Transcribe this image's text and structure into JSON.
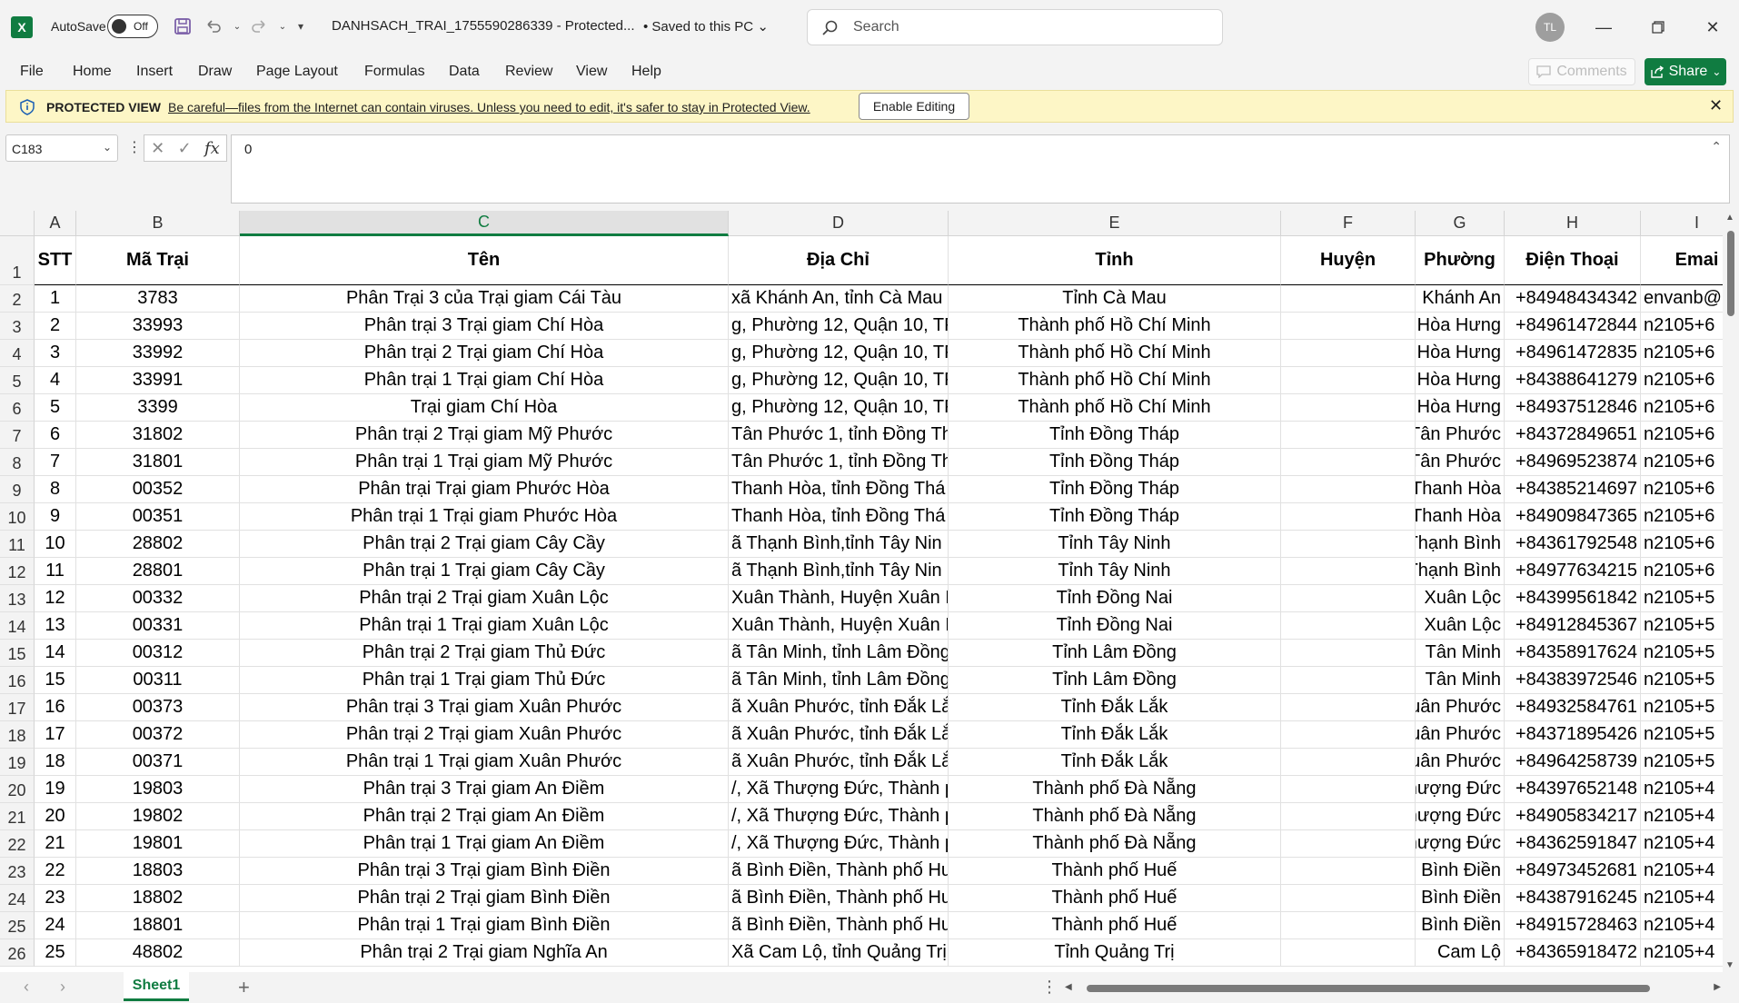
{
  "titlebar": {
    "app_logo": "X",
    "autosave_label": "AutoSave",
    "autosave_state": "Off",
    "filename": "DANHSACH_TRAI_1755590286339  -  Protected...",
    "saved_status": "•  Saved to this PC",
    "search_placeholder": "Search",
    "user_initials": "TL"
  },
  "menu": {
    "items": [
      "File",
      "Home",
      "Insert",
      "Draw",
      "Page Layout",
      "Formulas",
      "Data",
      "Review",
      "View",
      "Help"
    ],
    "comments": "Comments",
    "share": "Share"
  },
  "protected_view": {
    "title": "PROTECTED VIEW",
    "message": "Be careful—files from the Internet can contain viruses. Unless you need to edit, it's safer to stay in Protected View.",
    "button": "Enable Editing"
  },
  "formula_bar": {
    "name_box": "C183",
    "fx": "fx",
    "value": "0"
  },
  "sheet": {
    "columns": [
      "A",
      "B",
      "C",
      "D",
      "E",
      "F",
      "G",
      "H",
      "I"
    ],
    "selected_column": "C",
    "row_numbers": [
      "1",
      "2",
      "3",
      "4",
      "5",
      "6",
      "7",
      "8",
      "9",
      "10",
      "11",
      "12",
      "13",
      "14",
      "15",
      "16",
      "17",
      "18",
      "19",
      "20",
      "21",
      "22",
      "23",
      "24",
      "25",
      "26"
    ],
    "headers": [
      "STT",
      "Mã Trại",
      "Tên",
      "Địa Chỉ",
      "Tỉnh",
      "Huyện",
      "Phường",
      "Điện Thoại",
      "Emai"
    ],
    "rows": [
      [
        "1",
        "3783",
        "Phân Trại 3 của Trại giam Cái Tàu",
        "xã Khánh An, tỉnh Cà Mau",
        "Tỉnh Cà Mau",
        "",
        "Khánh An",
        "+84948434342",
        "envanb@"
      ],
      [
        "2",
        "33993",
        "Phân trại 3 Trại giam Chí Hòa",
        "g, Phường 12, Quận 10, TP",
        "Thành phố Hồ Chí Minh",
        "",
        "Hòa Hưng",
        "+84961472844",
        "n2105+6"
      ],
      [
        "3",
        "33992",
        "Phân trại 2 Trại giam Chí Hòa",
        "g, Phường 12, Quận 10, TP",
        "Thành phố Hồ Chí Minh",
        "",
        "Hòa Hưng",
        "+84961472835",
        "n2105+6"
      ],
      [
        "4",
        "33991",
        "Phân trại 1 Trại giam Chí Hòa",
        "g, Phường 12, Quận 10, TP",
        "Thành phố Hồ Chí Minh",
        "",
        "Hòa Hưng",
        "+84388641279",
        "n2105+6"
      ],
      [
        "5",
        "3399",
        "Trại giam Chí Hòa",
        "g, Phường 12, Quận 10, TP",
        "Thành phố Hồ Chí Minh",
        "",
        "Hòa Hưng",
        "+84937512846",
        "n2105+6"
      ],
      [
        "6",
        "31802",
        "Phân trại 2 Trại giam Mỹ Phước",
        "Tân Phước 1, tỉnh Đồng Th",
        "Tỉnh Đồng Tháp",
        "",
        "Tân Phước",
        "+84372849651",
        "n2105+6"
      ],
      [
        "7",
        "31801",
        "Phân trại 1 Trại giam Mỹ Phước",
        "Tân Phước 1, tỉnh Đồng Th",
        "Tỉnh Đồng Tháp",
        "",
        "Tân Phước",
        "+84969523874",
        "n2105+6"
      ],
      [
        "8",
        "00352",
        "Phân trại  Trại giam Phước Hòa",
        "Thanh Hòa, tỉnh Đồng Thá",
        "Tỉnh Đồng Tháp",
        "",
        "Thanh Hòa",
        "+84385214697",
        "n2105+6"
      ],
      [
        "9",
        "00351",
        "Phân trại 1 Trại giam Phước Hòa",
        "Thanh Hòa, tỉnh Đồng Thá",
        "Tỉnh Đồng Tháp",
        "",
        "Thanh Hòa",
        "+84909847365",
        "n2105+6"
      ],
      [
        "10",
        "28802",
        "Phân trại 2 Trại giam Cây Cầy",
        "ã Thạnh Bình,tỉnh Tây Nin",
        "Tỉnh Tây Ninh",
        "",
        "Thạnh Bình",
        "+84361792548",
        "n2105+6"
      ],
      [
        "11",
        "28801",
        "Phân trại 1 Trại giam Cây Cầy",
        "ã Thạnh Bình,tỉnh Tây Nin",
        "Tỉnh Tây Ninh",
        "",
        "Thạnh Bình",
        "+84977634215",
        "n2105+6"
      ],
      [
        "12",
        "00332",
        "Phân trại 2 Trại giam Xuân Lộc",
        "Xuân Thành, Huyện Xuân L",
        "Tỉnh Đồng Nai",
        "",
        "Xuân Lộc",
        "+84399561842",
        "n2105+5"
      ],
      [
        "13",
        "00331",
        "Phân trại 1 Trại giam Xuân Lộc",
        "Xuân Thành, Huyện Xuân L",
        "Tỉnh Đồng Nai",
        "",
        "Xuân Lộc",
        "+84912845367",
        "n2105+5"
      ],
      [
        "14",
        "00312",
        "Phân trại 2 Trại giam Thủ Đức",
        "ã Tân Minh, tỉnh Lâm Đồng",
        "Tỉnh Lâm Đồng",
        "",
        "Tân Minh",
        "+84358917624",
        "n2105+5"
      ],
      [
        "15",
        "00311",
        "Phân trại 1 Trại giam Thủ Đức",
        "ã Tân Minh, tỉnh Lâm Đồng",
        "Tỉnh Lâm Đồng",
        "",
        "Tân Minh",
        "+84383972546",
        "n2105+5"
      ],
      [
        "16",
        "00373",
        "Phân trại 3 Trại giam Xuân Phước",
        "ã Xuân Phước, tỉnh Đắk Lắ",
        "Tỉnh Đắk Lắk",
        "",
        "Xuân Phước",
        "+84932584761",
        "n2105+5"
      ],
      [
        "17",
        "00372",
        "Phân trại 2 Trại giam Xuân Phước",
        "ã Xuân Phước, tỉnh Đắk Lắ",
        "Tỉnh Đắk Lắk",
        "",
        "Xuân Phước",
        "+84371895426",
        "n2105+5"
      ],
      [
        "18",
        "00371",
        "Phân trại 1 Trại giam Xuân Phước",
        "ã Xuân Phước, tỉnh Đắk Lắ",
        "Tỉnh Đắk Lắk",
        "",
        "Xuân Phước",
        "+84964258739",
        "n2105+5"
      ],
      [
        "19",
        "19803",
        "Phân trại 3 Trại giam An Điềm",
        "/, Xã Thượng Đức, Thành p",
        "Thành phố Đà Nẵng",
        "",
        "Thượng Đức",
        "+84397652148",
        "n2105+4"
      ],
      [
        "20",
        "19802",
        "Phân trại 2 Trại giam An Điềm",
        "/, Xã Thượng Đức, Thành p",
        "Thành phố Đà Nẵng",
        "",
        "Thượng Đức",
        "+84905834217",
        "n2105+4"
      ],
      [
        "21",
        "19801",
        "Phân trại 1 Trại giam An Điềm",
        "/, Xã Thượng Đức, Thành p",
        "Thành phố Đà Nẵng",
        "",
        "Thượng Đức",
        "+84362591847",
        "n2105+4"
      ],
      [
        "22",
        "18803",
        "Phân trại 3 Trại giam Bình Điền",
        "ã Bình Điền, Thành phố Hu",
        "Thành phố Huế",
        "",
        "Bình Điền",
        "+84973452681",
        "n2105+4"
      ],
      [
        "23",
        "18802",
        "Phân trại 2 Trại giam Bình Điền",
        "ã Bình Điền, Thành phố Hu",
        "Thành phố Huế",
        "",
        "Bình Điền",
        "+84387916245",
        "n2105+4"
      ],
      [
        "24",
        "18801",
        "Phân trại 1 Trại giam Bình Điền",
        "ã Bình Điền, Thành phố Hu",
        "Thành phố Huế",
        "",
        "Bình Điền",
        "+84915728463",
        "n2105+4"
      ],
      [
        "25",
        "48802",
        "Phân trại 2 Trại giam Nghĩa An",
        "Xã Cam Lộ, tỉnh Quảng Trị",
        "Tỉnh Quảng Trị",
        "",
        "Cam Lộ",
        "+84365918472",
        "n2105+4"
      ]
    ],
    "tab_name": "Sheet1"
  },
  "colors": {
    "accent": "#107c41",
    "protected_bar": "#fdf6c6"
  }
}
